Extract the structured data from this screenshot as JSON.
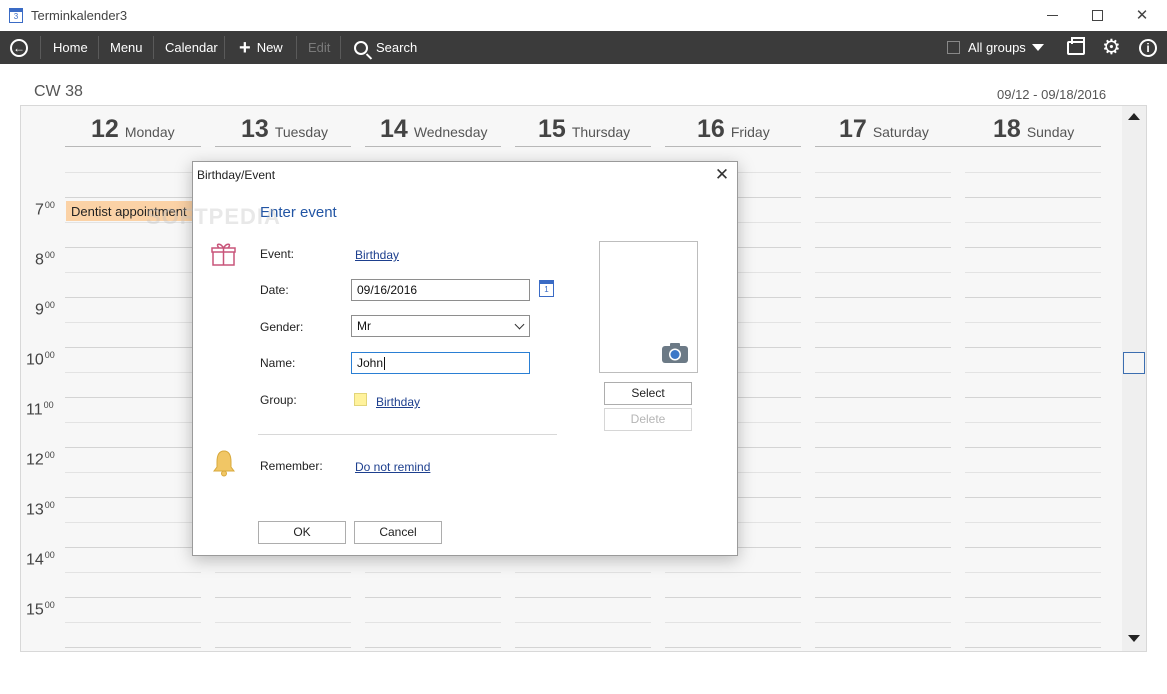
{
  "window": {
    "title": "Terminkalender3"
  },
  "toolbar": {
    "home": "Home",
    "menu": "Menu",
    "calendar": "Calendar",
    "new": "New",
    "edit": "Edit",
    "search": "Search",
    "all_groups": "All groups"
  },
  "calendar": {
    "week_label": "CW 38",
    "date_range": "09/12 - 09/18/2016",
    "days": [
      {
        "num": "12",
        "name": "Monday"
      },
      {
        "num": "13",
        "name": "Tuesday"
      },
      {
        "num": "14",
        "name": "Wednesday"
      },
      {
        "num": "15",
        "name": "Thursday"
      },
      {
        "num": "16",
        "name": "Friday"
      },
      {
        "num": "17",
        "name": "Saturday"
      },
      {
        "num": "18",
        "name": "Sunday"
      }
    ],
    "hours": [
      {
        "h": "7",
        "m": "00"
      },
      {
        "h": "8",
        "m": "00"
      },
      {
        "h": "9",
        "m": "00"
      },
      {
        "h": "10",
        "m": "00"
      },
      {
        "h": "11",
        "m": "00"
      },
      {
        "h": "12",
        "m": "00"
      },
      {
        "h": "13",
        "m": "00"
      },
      {
        "h": "14",
        "m": "00"
      },
      {
        "h": "15",
        "m": "00"
      }
    ],
    "appointment": "Dentist appointment",
    "colors": {
      "appointment": "#fbd2a6",
      "accent": "#2255a4",
      "toolbar": "#3b3b3b"
    }
  },
  "dialog": {
    "title": "Birthday/Event",
    "heading": "Enter event",
    "event_label": "Event:",
    "event_value": "Birthday",
    "date_label": "Date:",
    "date_value": "09/16/2016",
    "gender_label": "Gender:",
    "gender_value": "Mr",
    "name_label": "Name:",
    "name_value": "John",
    "group_label": "Group:",
    "group_value": "Birthday",
    "remember_label": "Remember:",
    "remember_value": "Do not remind",
    "select_button": "Select",
    "delete_button": "Delete",
    "ok_button": "OK",
    "cancel_button": "Cancel",
    "group_color": "#fff29c"
  },
  "watermark": "SOFTPEDIA"
}
